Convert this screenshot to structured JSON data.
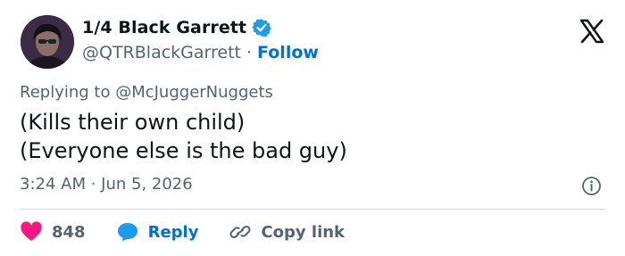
{
  "author": {
    "display_name": "1/4 Black Garrett",
    "handle": "@QTRBlackGarrett",
    "separator": "·",
    "follow_label": "Follow"
  },
  "reply_context": "Replying to @McJuggerNuggets",
  "tweet": {
    "lines": [
      "(Kills their own child)",
      "(Everyone else is the bad guy)"
    ]
  },
  "meta": {
    "timestamp": "3:24 AM · Jun 5, 2026"
  },
  "actions": {
    "like_count": "848",
    "reply_label": "Reply",
    "copy_label": "Copy link"
  },
  "colors": {
    "like_red": "#f91880",
    "reply_blue": "#1d9bf0",
    "verified_blue": "#1d9bf0",
    "text_primary": "#0f1419",
    "text_secondary": "#536471"
  },
  "icons": [
    "verified-icon",
    "x-logo-icon",
    "info-icon",
    "heart-icon",
    "reply-bubble-icon",
    "link-icon"
  ]
}
